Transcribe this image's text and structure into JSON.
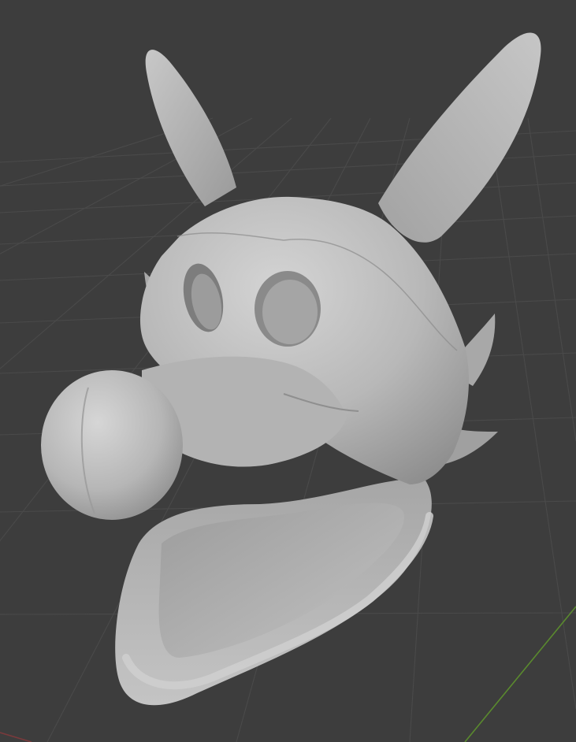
{
  "viewport": {
    "background_color": "#3d3d3d",
    "grid_line_color": "#484848",
    "axis_x_color": "#7a3a3c",
    "axis_y_color": "#5a8a2e",
    "model_base_color": "#b9b9b9"
  },
  "model": {
    "name": "",
    "icon": "sculpted-head-mesh"
  }
}
